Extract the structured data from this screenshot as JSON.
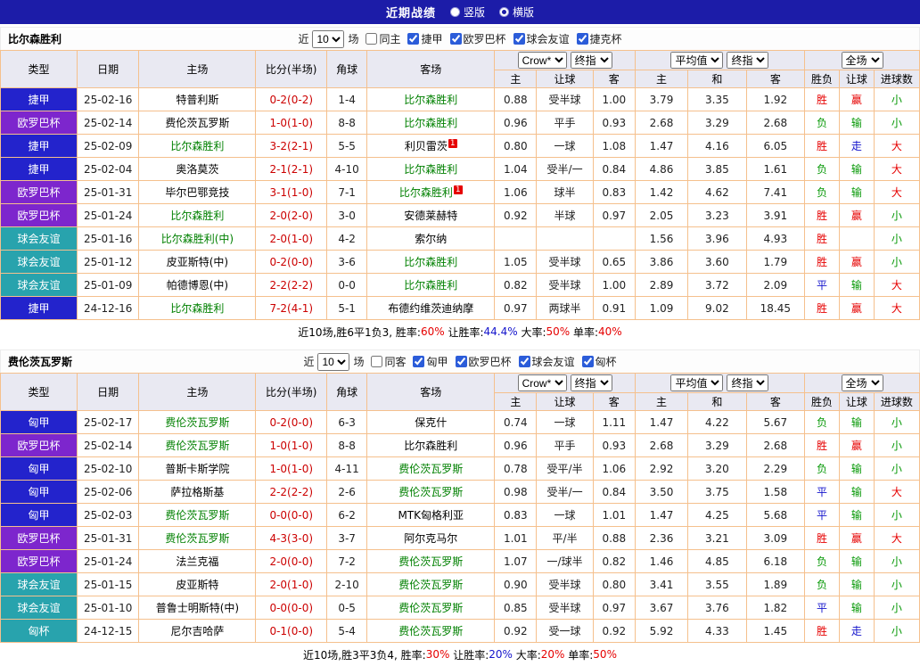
{
  "header": {
    "title": "近期战绩",
    "layout_options": [
      {
        "label": "竖版",
        "selected": false
      },
      {
        "label": "横版",
        "selected": true
      }
    ]
  },
  "colors": {
    "topbar_bg": "#1c1ca8",
    "focus_team": "#008000",
    "score": "#cc0000",
    "table_border": "#f5c08d",
    "header_bg": "#e9e9f2",
    "league": {
      "捷甲": "#2323cc",
      "匈甲": "#2323cc",
      "欧罗巴杯": "#7d26cd",
      "球会友谊": "#28a3ad",
      "匈杯": "#28a3ad",
      "捷克杯": "#28a3ad"
    },
    "result": {
      "胜": "#e60000",
      "平": "#1414cc",
      "负": "#089908",
      "赢": "#e60000",
      "走": "#1414cc",
      "输": "#089908",
      "大": "#e60000",
      "小": "#089908"
    }
  },
  "filter_labels": {
    "near": "近",
    "games": "场"
  },
  "table_header": {
    "static_cols": [
      "类型",
      "日期",
      "主场",
      "比分(半场)",
      "角球",
      "客场"
    ],
    "groups": [
      {
        "selects": [
          "Crow*",
          "终指"
        ],
        "select_names": [
          "odds-source-select",
          "odds-stage-select"
        ],
        "subcols": [
          "主",
          "让球",
          "客"
        ]
      },
      {
        "selects": [
          "平均值",
          "终指"
        ],
        "select_names": [
          "avg-source-select",
          "avg-stage-select"
        ],
        "subcols": [
          "主",
          "和",
          "客"
        ]
      },
      {
        "selects": [
          "全场"
        ],
        "select_names": [
          "fulltime-scope-select"
        ],
        "subcols": [
          "胜负",
          "让球",
          "进球数"
        ]
      }
    ]
  },
  "sections": [
    {
      "team": "比尔森胜利",
      "filter": {
        "count": "10",
        "checkboxes": [
          {
            "label": "同主",
            "checked": false
          },
          {
            "label": "捷甲",
            "checked": true
          },
          {
            "label": "欧罗巴杯",
            "checked": true
          },
          {
            "label": "球会友谊",
            "checked": true
          },
          {
            "label": "捷克杯",
            "checked": true
          }
        ]
      },
      "rows": [
        {
          "league": "捷甲",
          "date": "25-02-16",
          "home": {
            "name": "特普利斯",
            "focus": false
          },
          "score": "0-2(0-2)",
          "corner": "1-4",
          "away": {
            "name": "比尔森胜利",
            "focus": true
          },
          "odds": [
            "0.88",
            "受半球",
            "1.00"
          ],
          "avg": [
            "3.79",
            "3.35",
            "1.92"
          ],
          "results": [
            "胜",
            "赢",
            "小"
          ]
        },
        {
          "league": "欧罗巴杯",
          "date": "25-02-14",
          "home": {
            "name": "费伦茨瓦罗斯",
            "focus": false
          },
          "score": "1-0(1-0)",
          "corner": "8-8",
          "away": {
            "name": "比尔森胜利",
            "focus": true
          },
          "odds": [
            "0.96",
            "平手",
            "0.93"
          ],
          "avg": [
            "2.68",
            "3.29",
            "2.68"
          ],
          "results": [
            "负",
            "输",
            "小"
          ]
        },
        {
          "league": "捷甲",
          "date": "25-02-09",
          "home": {
            "name": "比尔森胜利",
            "focus": true
          },
          "score": "3-2(2-1)",
          "corner": "5-5",
          "away": {
            "name": "利贝雷茨",
            "focus": false,
            "sup": "1"
          },
          "odds": [
            "0.80",
            "一球",
            "1.08"
          ],
          "avg": [
            "1.47",
            "4.16",
            "6.05"
          ],
          "results": [
            "胜",
            "走",
            "大"
          ]
        },
        {
          "league": "捷甲",
          "date": "25-02-04",
          "home": {
            "name": "奥洛莫茨",
            "focus": false
          },
          "score": "2-1(2-1)",
          "corner": "4-10",
          "away": {
            "name": "比尔森胜利",
            "focus": true
          },
          "odds": [
            "1.04",
            "受半/一",
            "0.84"
          ],
          "avg": [
            "4.86",
            "3.85",
            "1.61"
          ],
          "results": [
            "负",
            "输",
            "大"
          ]
        },
        {
          "league": "欧罗巴杯",
          "date": "25-01-31",
          "home": {
            "name": "毕尔巴鄂竞技",
            "focus": false
          },
          "score": "3-1(1-0)",
          "corner": "7-1",
          "away": {
            "name": "比尔森胜利",
            "focus": true,
            "sup": "1"
          },
          "odds": [
            "1.06",
            "球半",
            "0.83"
          ],
          "avg": [
            "1.42",
            "4.62",
            "7.41"
          ],
          "results": [
            "负",
            "输",
            "大"
          ]
        },
        {
          "league": "欧罗巴杯",
          "date": "25-01-24",
          "home": {
            "name": "比尔森胜利",
            "focus": true
          },
          "score": "2-0(2-0)",
          "corner": "3-0",
          "away": {
            "name": "安德莱赫特",
            "focus": false
          },
          "odds": [
            "0.92",
            "半球",
            "0.97"
          ],
          "avg": [
            "2.05",
            "3.23",
            "3.91"
          ],
          "results": [
            "胜",
            "赢",
            "小"
          ]
        },
        {
          "league": "球会友谊",
          "date": "25-01-16",
          "home": {
            "name": "比尔森胜利(中)",
            "focus": true
          },
          "score": "2-0(1-0)",
          "corner": "4-2",
          "away": {
            "name": "索尔纳",
            "focus": false
          },
          "odds": [
            "",
            "",
            ""
          ],
          "avg": [
            "1.56",
            "3.96",
            "4.93"
          ],
          "results": [
            "胜",
            "",
            "小"
          ]
        },
        {
          "league": "球会友谊",
          "date": "25-01-12",
          "home": {
            "name": "皮亚斯特(中)",
            "focus": false
          },
          "score": "0-2(0-0)",
          "corner": "3-6",
          "away": {
            "name": "比尔森胜利",
            "focus": true
          },
          "odds": [
            "1.05",
            "受半球",
            "0.65"
          ],
          "avg": [
            "3.86",
            "3.60",
            "1.79"
          ],
          "results": [
            "胜",
            "赢",
            "小"
          ]
        },
        {
          "league": "球会友谊",
          "date": "25-01-09",
          "home": {
            "name": "帕德博恩(中)",
            "focus": false
          },
          "score": "2-2(2-2)",
          "corner": "0-0",
          "away": {
            "name": "比尔森胜利",
            "focus": true
          },
          "odds": [
            "0.82",
            "受半球",
            "1.00"
          ],
          "avg": [
            "2.89",
            "3.72",
            "2.09"
          ],
          "results": [
            "平",
            "输",
            "大"
          ]
        },
        {
          "league": "捷甲",
          "date": "24-12-16",
          "home": {
            "name": "比尔森胜利",
            "focus": true
          },
          "score": "7-2(4-1)",
          "corner": "5-1",
          "away": {
            "name": "布德约维茨迪纳摩",
            "focus": false
          },
          "odds": [
            "0.97",
            "两球半",
            "0.91"
          ],
          "avg": [
            "1.09",
            "9.02",
            "18.45"
          ],
          "results": [
            "胜",
            "赢",
            "大"
          ]
        }
      ],
      "summary": [
        {
          "text": "近10场,胜6平1负3, 胜率:",
          "color": "#000000"
        },
        {
          "text": "60%",
          "color": "#e60000"
        },
        {
          "text": " 让胜率:",
          "color": "#000000"
        },
        {
          "text": "44.4%",
          "color": "#1414cc"
        },
        {
          "text": " 大率:",
          "color": "#000000"
        },
        {
          "text": "50%",
          "color": "#e60000"
        },
        {
          "text": " 单率:",
          "color": "#000000"
        },
        {
          "text": "40%",
          "color": "#e60000"
        }
      ]
    },
    {
      "team": "费伦茨瓦罗斯",
      "filter": {
        "count": "10",
        "checkboxes": [
          {
            "label": "同客",
            "checked": false
          },
          {
            "label": "匈甲",
            "checked": true
          },
          {
            "label": "欧罗巴杯",
            "checked": true
          },
          {
            "label": "球会友谊",
            "checked": true
          },
          {
            "label": "匈杯",
            "checked": true
          }
        ]
      },
      "rows": [
        {
          "league": "匈甲",
          "date": "25-02-17",
          "home": {
            "name": "费伦茨瓦罗斯",
            "focus": true
          },
          "score": "0-2(0-0)",
          "corner": "6-3",
          "away": {
            "name": "保克什",
            "focus": false
          },
          "odds": [
            "0.74",
            "一球",
            "1.11"
          ],
          "avg": [
            "1.47",
            "4.22",
            "5.67"
          ],
          "results": [
            "负",
            "输",
            "小"
          ]
        },
        {
          "league": "欧罗巴杯",
          "date": "25-02-14",
          "home": {
            "name": "费伦茨瓦罗斯",
            "focus": true
          },
          "score": "1-0(1-0)",
          "corner": "8-8",
          "away": {
            "name": "比尔森胜利",
            "focus": false
          },
          "odds": [
            "0.96",
            "平手",
            "0.93"
          ],
          "avg": [
            "2.68",
            "3.29",
            "2.68"
          ],
          "results": [
            "胜",
            "赢",
            "小"
          ]
        },
        {
          "league": "匈甲",
          "date": "25-02-10",
          "home": {
            "name": "普斯卡斯学院",
            "focus": false
          },
          "score": "1-0(1-0)",
          "corner": "4-11",
          "away": {
            "name": "费伦茨瓦罗斯",
            "focus": true
          },
          "odds": [
            "0.78",
            "受平/半",
            "1.06"
          ],
          "avg": [
            "2.92",
            "3.20",
            "2.29"
          ],
          "results": [
            "负",
            "输",
            "小"
          ]
        },
        {
          "league": "匈甲",
          "date": "25-02-06",
          "home": {
            "name": "萨拉格斯基",
            "focus": false
          },
          "score": "2-2(2-2)",
          "corner": "2-6",
          "away": {
            "name": "费伦茨瓦罗斯",
            "focus": true
          },
          "odds": [
            "0.98",
            "受半/一",
            "0.84"
          ],
          "avg": [
            "3.50",
            "3.75",
            "1.58"
          ],
          "results": [
            "平",
            "输",
            "大"
          ]
        },
        {
          "league": "匈甲",
          "date": "25-02-03",
          "home": {
            "name": "费伦茨瓦罗斯",
            "focus": true
          },
          "score": "0-0(0-0)",
          "corner": "6-2",
          "away": {
            "name": "MTK匈格利亚",
            "focus": false
          },
          "odds": [
            "0.83",
            "一球",
            "1.01"
          ],
          "avg": [
            "1.47",
            "4.25",
            "5.68"
          ],
          "results": [
            "平",
            "输",
            "小"
          ]
        },
        {
          "league": "欧罗巴杯",
          "date": "25-01-31",
          "home": {
            "name": "费伦茨瓦罗斯",
            "focus": true
          },
          "score": "4-3(3-0)",
          "corner": "3-7",
          "away": {
            "name": "阿尔克马尔",
            "focus": false
          },
          "odds": [
            "1.01",
            "平/半",
            "0.88"
          ],
          "avg": [
            "2.36",
            "3.21",
            "3.09"
          ],
          "results": [
            "胜",
            "赢",
            "大"
          ]
        },
        {
          "league": "欧罗巴杯",
          "date": "25-01-24",
          "home": {
            "name": "法兰克福",
            "focus": false
          },
          "score": "2-0(0-0)",
          "corner": "7-2",
          "away": {
            "name": "费伦茨瓦罗斯",
            "focus": true
          },
          "odds": [
            "1.07",
            "一/球半",
            "0.82"
          ],
          "avg": [
            "1.46",
            "4.85",
            "6.18"
          ],
          "results": [
            "负",
            "输",
            "小"
          ]
        },
        {
          "league": "球会友谊",
          "date": "25-01-15",
          "home": {
            "name": "皮亚斯特",
            "focus": false
          },
          "score": "2-0(1-0)",
          "corner": "2-10",
          "away": {
            "name": "费伦茨瓦罗斯",
            "focus": true
          },
          "odds": [
            "0.90",
            "受半球",
            "0.80"
          ],
          "avg": [
            "3.41",
            "3.55",
            "1.89"
          ],
          "results": [
            "负",
            "输",
            "小"
          ]
        },
        {
          "league": "球会友谊",
          "date": "25-01-10",
          "home": {
            "name": "普鲁士明斯特(中)",
            "focus": false
          },
          "score": "0-0(0-0)",
          "corner": "0-5",
          "away": {
            "name": "费伦茨瓦罗斯",
            "focus": true
          },
          "odds": [
            "0.85",
            "受半球",
            "0.97"
          ],
          "avg": [
            "3.67",
            "3.76",
            "1.82"
          ],
          "results": [
            "平",
            "输",
            "小"
          ]
        },
        {
          "league": "匈杯",
          "date": "24-12-15",
          "home": {
            "name": "尼尔吉哈萨",
            "focus": false
          },
          "score": "0-1(0-0)",
          "corner": "5-4",
          "away": {
            "name": "费伦茨瓦罗斯",
            "focus": true
          },
          "odds": [
            "0.92",
            "受一球",
            "0.92"
          ],
          "avg": [
            "5.92",
            "4.33",
            "1.45"
          ],
          "results": [
            "胜",
            "走",
            "小"
          ]
        }
      ],
      "summary": [
        {
          "text": "近10场,胜3平3负4, 胜率:",
          "color": "#000000"
        },
        {
          "text": "30%",
          "color": "#e60000"
        },
        {
          "text": " 让胜率:",
          "color": "#000000"
        },
        {
          "text": "20%",
          "color": "#1414cc"
        },
        {
          "text": " 大率:",
          "color": "#000000"
        },
        {
          "text": "20%",
          "color": "#e60000"
        },
        {
          "text": " 单率:",
          "color": "#000000"
        },
        {
          "text": "50%",
          "color": "#e60000"
        }
      ]
    }
  ]
}
